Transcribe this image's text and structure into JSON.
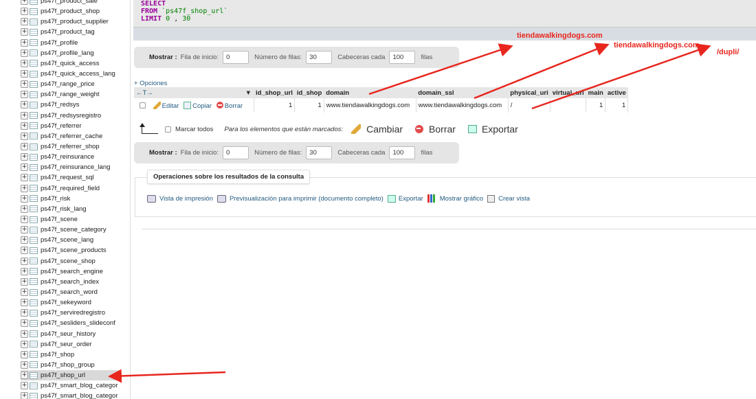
{
  "sidebar": {
    "items": [
      "ps47f_product_sale",
      "ps47f_product_shop",
      "ps47f_product_supplier",
      "ps47f_product_tag",
      "ps47f_profile",
      "ps47f_profile_lang",
      "ps47f_quick_access",
      "ps47f_quick_access_lang",
      "ps47f_range_price",
      "ps47f_range_weight",
      "ps47f_redsys",
      "ps47f_redsysregistro",
      "ps47f_referrer",
      "ps47f_referrer_cache",
      "ps47f_referrer_shop",
      "ps47f_reinsurance",
      "ps47f_reinsurance_lang",
      "ps47f_request_sql",
      "ps47f_required_field",
      "ps47f_risk",
      "ps47f_risk_lang",
      "ps47f_scene",
      "ps47f_scene_category",
      "ps47f_scene_lang",
      "ps47f_scene_products",
      "ps47f_scene_shop",
      "ps47f_search_engine",
      "ps47f_search_index",
      "ps47f_search_word",
      "ps47f_sekeyword",
      "ps47f_serviredregistro",
      "ps47f_sesliders_slideconf",
      "ps47f_seur_history",
      "ps47f_seur_order",
      "ps47f_shop",
      "ps47f_shop_group",
      "ps47f_shop_url",
      "ps47f_smart_blog_categor",
      "ps47f_smart_blog_categor"
    ],
    "active_item": "ps47f_shop_url",
    "expand_glyph": "+"
  },
  "sql": {
    "select_kw": "SELECT",
    "from_kw": "FROM",
    "from_table": "`ps47f_shop_url`",
    "limit_kw": "LIMIT",
    "limit_a": "0",
    "limit_sep": ",",
    "limit_b": "30"
  },
  "nav": {
    "show_label": "Mostrar :",
    "start_label": "Fila de inicio:",
    "start_value": "0",
    "rows_label": "Número de filas:",
    "rows_value": "30",
    "headers_label": "Cabeceras cada",
    "headers_value": "100",
    "rows_unit": "filas"
  },
  "options_link": "+ Opciones",
  "col_nav": "←T→",
  "sort_glyph": "▼",
  "table": {
    "columns": [
      "id_shop_url",
      "id_shop",
      "domain",
      "domain_ssl",
      "physical_uri",
      "virtual_uri",
      "main",
      "active"
    ],
    "rows": [
      {
        "edit": "Editar",
        "copy": "Copiar",
        "delete": "Borrar",
        "id_shop_url": "1",
        "id_shop": "1",
        "domain": "www.tiendawalkingdogs.com",
        "domain_ssl": "www.tiendawalkingdogs.com",
        "physical_uri": "/",
        "virtual_uri": "",
        "main": "1",
        "active": "1"
      }
    ]
  },
  "bulk": {
    "check_all": "Marcar todos",
    "for_selected": "Para los elementos que están marcados:",
    "change": "Cambiar",
    "delete": "Borrar",
    "export": "Exportar"
  },
  "ops": {
    "title": "Operaciones sobre los resultados de la consulta",
    "print_view": "Vista de impresión",
    "print_preview": "Previsualización para imprimir (documento completo)",
    "export": "Exportar",
    "chart": "Mostrar gráfico",
    "create_view": "Crear vista"
  },
  "annotations": {
    "label1": "tiendawalkingdogs.com",
    "label2": "tiendawalkingdogs.com",
    "label3": "/dupli/",
    "color": "#e8261e"
  }
}
